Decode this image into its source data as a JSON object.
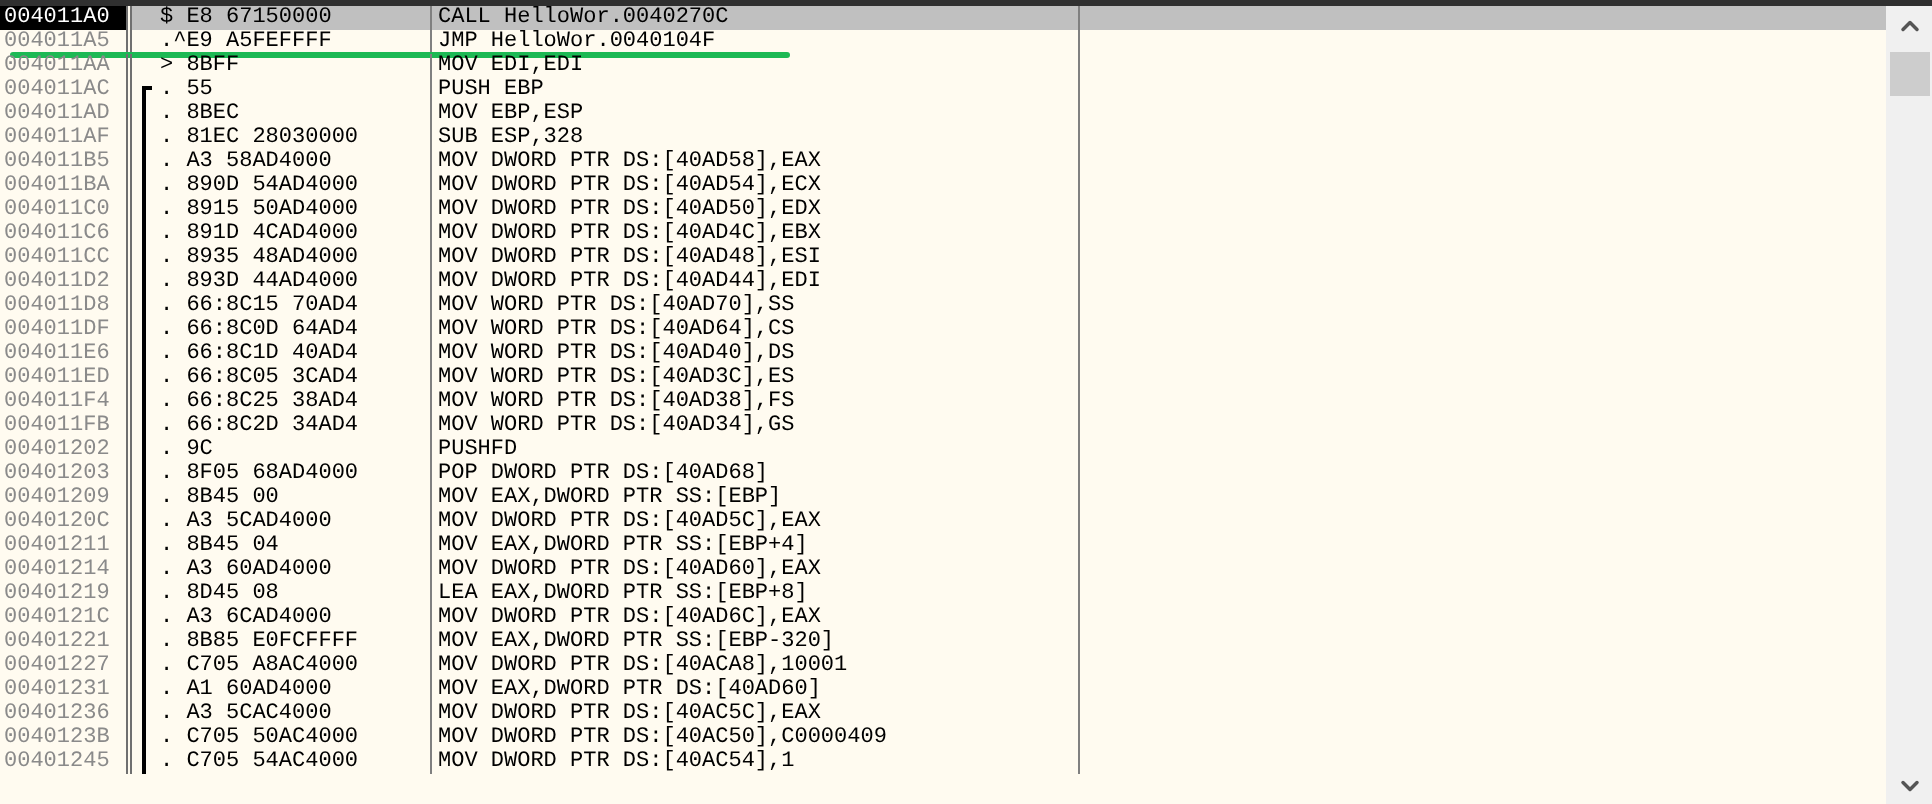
{
  "rows": [
    {
      "address": "004011A0",
      "hex": "$ E8 67150000",
      "disasm": "CALL HelloWor.0040270C",
      "selected": true
    },
    {
      "address": "004011A5",
      "hex": ".^E9 A5FEFFFF",
      "disasm": "JMP HelloWor.0040104F",
      "selected": false,
      "underlined": true
    },
    {
      "address": "004011AA",
      "hex": "> 8BFF",
      "disasm": "MOV EDI,EDI",
      "selected": false
    },
    {
      "address": "004011AC",
      "hex": ". 55",
      "disasm": "PUSH EBP",
      "selected": false,
      "procedure_start": true
    },
    {
      "address": "004011AD",
      "hex": ". 8BEC",
      "disasm": "MOV EBP,ESP",
      "selected": false,
      "in_procedure": true
    },
    {
      "address": "004011AF",
      "hex": ". 81EC 28030000",
      "disasm": "SUB ESP,328",
      "selected": false,
      "in_procedure": true
    },
    {
      "address": "004011B5",
      "hex": ". A3 58AD4000",
      "disasm": "MOV DWORD PTR DS:[40AD58],EAX",
      "selected": false,
      "in_procedure": true
    },
    {
      "address": "004011BA",
      "hex": ". 890D 54AD4000",
      "disasm": "MOV DWORD PTR DS:[40AD54],ECX",
      "selected": false,
      "in_procedure": true
    },
    {
      "address": "004011C0",
      "hex": ". 8915 50AD4000",
      "disasm": "MOV DWORD PTR DS:[40AD50],EDX",
      "selected": false,
      "in_procedure": true
    },
    {
      "address": "004011C6",
      "hex": ". 891D 4CAD4000",
      "disasm": "MOV DWORD PTR DS:[40AD4C],EBX",
      "selected": false,
      "in_procedure": true
    },
    {
      "address": "004011CC",
      "hex": ". 8935 48AD4000",
      "disasm": "MOV DWORD PTR DS:[40AD48],ESI",
      "selected": false,
      "in_procedure": true
    },
    {
      "address": "004011D2",
      "hex": ". 893D 44AD4000",
      "disasm": "MOV DWORD PTR DS:[40AD44],EDI",
      "selected": false,
      "in_procedure": true
    },
    {
      "address": "004011D8",
      "hex": ". 66:8C15 70AD4",
      "disasm": "MOV WORD PTR DS:[40AD70],SS",
      "selected": false,
      "in_procedure": true
    },
    {
      "address": "004011DF",
      "hex": ". 66:8C0D 64AD4",
      "disasm": "MOV WORD PTR DS:[40AD64],CS",
      "selected": false,
      "in_procedure": true
    },
    {
      "address": "004011E6",
      "hex": ". 66:8C1D 40AD4",
      "disasm": "MOV WORD PTR DS:[40AD40],DS",
      "selected": false,
      "in_procedure": true
    },
    {
      "address": "004011ED",
      "hex": ". 66:8C05 3CAD4",
      "disasm": "MOV WORD PTR DS:[40AD3C],ES",
      "selected": false,
      "in_procedure": true
    },
    {
      "address": "004011F4",
      "hex": ". 66:8C25 38AD4",
      "disasm": "MOV WORD PTR DS:[40AD38],FS",
      "selected": false,
      "in_procedure": true
    },
    {
      "address": "004011FB",
      "hex": ". 66:8C2D 34AD4",
      "disasm": "MOV WORD PTR DS:[40AD34],GS",
      "selected": false,
      "in_procedure": true
    },
    {
      "address": "00401202",
      "hex": ". 9C",
      "disasm": "PUSHFD",
      "selected": false,
      "in_procedure": true
    },
    {
      "address": "00401203",
      "hex": ". 8F05 68AD4000",
      "disasm": "POP DWORD PTR DS:[40AD68]",
      "selected": false,
      "in_procedure": true
    },
    {
      "address": "00401209",
      "hex": ". 8B45 00",
      "disasm": "MOV EAX,DWORD PTR SS:[EBP]",
      "selected": false,
      "in_procedure": true
    },
    {
      "address": "0040120C",
      "hex": ". A3 5CAD4000",
      "disasm": "MOV DWORD PTR DS:[40AD5C],EAX",
      "selected": false,
      "in_procedure": true
    },
    {
      "address": "00401211",
      "hex": ". 8B45 04",
      "disasm": "MOV EAX,DWORD PTR SS:[EBP+4]",
      "selected": false,
      "in_procedure": true
    },
    {
      "address": "00401214",
      "hex": ". A3 60AD4000",
      "disasm": "MOV DWORD PTR DS:[40AD60],EAX",
      "selected": false,
      "in_procedure": true
    },
    {
      "address": "00401219",
      "hex": ". 8D45 08",
      "disasm": "LEA EAX,DWORD PTR SS:[EBP+8]",
      "selected": false,
      "in_procedure": true
    },
    {
      "address": "0040121C",
      "hex": ". A3 6CAD4000",
      "disasm": "MOV DWORD PTR DS:[40AD6C],EAX",
      "selected": false,
      "in_procedure": true
    },
    {
      "address": "00401221",
      "hex": ". 8B85 E0FCFFFF",
      "disasm": "MOV EAX,DWORD PTR SS:[EBP-320]",
      "selected": false,
      "in_procedure": true
    },
    {
      "address": "00401227",
      "hex": ". C705 A8AC4000",
      "disasm": "MOV DWORD PTR DS:[40ACA8],10001",
      "selected": false,
      "in_procedure": true
    },
    {
      "address": "00401231",
      "hex": ". A1 60AD4000",
      "disasm": "MOV EAX,DWORD PTR DS:[40AD60]",
      "selected": false,
      "in_procedure": true
    },
    {
      "address": "00401236",
      "hex": ". A3 5CAC4000",
      "disasm": "MOV DWORD PTR DS:[40AC5C],EAX",
      "selected": false,
      "in_procedure": true
    },
    {
      "address": "0040123B",
      "hex": ". C705 50AC4000",
      "disasm": "MOV DWORD PTR DS:[40AC50],C0000409",
      "selected": false,
      "in_procedure": true
    },
    {
      "address": "00401245",
      "hex": ". C705 54AC4000",
      "disasm": "MOV DWORD PTR DS:[40AC54],1",
      "selected": false,
      "in_procedure": true
    }
  ]
}
